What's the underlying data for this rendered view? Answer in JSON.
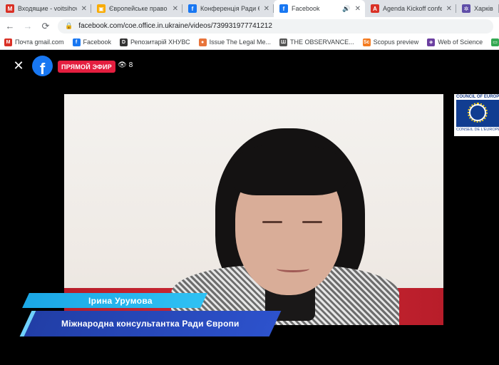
{
  "tabs": [
    {
      "title": "Входящие - voitsihovs",
      "icon": "gmail-icon",
      "color": "#d93025",
      "glyph": "M",
      "close": "✕"
    },
    {
      "title": "Європейське право",
      "icon": "classroom-icon",
      "color": "#f9ab00",
      "glyph": "▣",
      "close": "✕"
    },
    {
      "title": "Конференція Ради Є",
      "icon": "facebook-icon",
      "color": "#1877f2",
      "glyph": "f",
      "close": "✕"
    },
    {
      "title": "Facebook",
      "icon": "facebook-icon",
      "color": "#1877f2",
      "glyph": "f",
      "close": "✕",
      "active": true,
      "audio": "🔊"
    },
    {
      "title": "Agenda Kickoff confe",
      "icon": "pdf-icon",
      "color": "#d93025",
      "glyph": "A",
      "close": "✕"
    },
    {
      "title": "Харків",
      "icon": "gear-icon",
      "color": "#5f4ea8",
      "glyph": "✲",
      "close": ""
    }
  ],
  "address": {
    "url": "facebook.com/coe.office.in.ukraine/videos/739931977741212",
    "back": "←",
    "forward": "→",
    "reload": "⟳",
    "lock": "🔒"
  },
  "bookmarks": [
    {
      "label": "Почта gmail.com",
      "icon": "gmail-icon",
      "color": "#d93025",
      "glyph": "M"
    },
    {
      "label": "Facebook",
      "icon": "facebook-icon",
      "color": "#1877f2",
      "glyph": "f"
    },
    {
      "label": "Репозитарій ХНУВС",
      "icon": "d-icon",
      "color": "#333333",
      "glyph": "D"
    },
    {
      "label": "Issue The Legal Me...",
      "icon": "issue-icon",
      "color": "#e8743b",
      "glyph": "●"
    },
    {
      "label": "THE OBSERVANCE...",
      "icon": "columns-icon",
      "color": "#555555",
      "glyph": "Ш"
    },
    {
      "label": "Scopus preview",
      "icon": "scopus-icon",
      "color": "#f47b20",
      "glyph": "Sc"
    },
    {
      "label": "Web of Science",
      "icon": "wos-icon",
      "color": "#6b3fa0",
      "glyph": "◈"
    },
    {
      "label": "Tabletki",
      "icon": "tabletki-icon",
      "color": "#34a853",
      "glyph": "▭"
    }
  ],
  "viewer": {
    "close": "✕",
    "logo": "f",
    "live_label": "ПРЯМОЙ ЭФИР",
    "viewer_count": "8",
    "eye": "👁"
  },
  "coe": {
    "top": "COUNCIL OF EUROPE",
    "bottom": "CONSEIL DE L'EUROPE"
  },
  "lower_third": {
    "name": "Ірина Урумова",
    "title": "Міжнародна консультантка Ради Європи"
  },
  "colors": {
    "live": "#e41e3f",
    "facebook": "#1877f2",
    "name_bar": "#1ba7e6",
    "title_bar": "#213ea6"
  }
}
